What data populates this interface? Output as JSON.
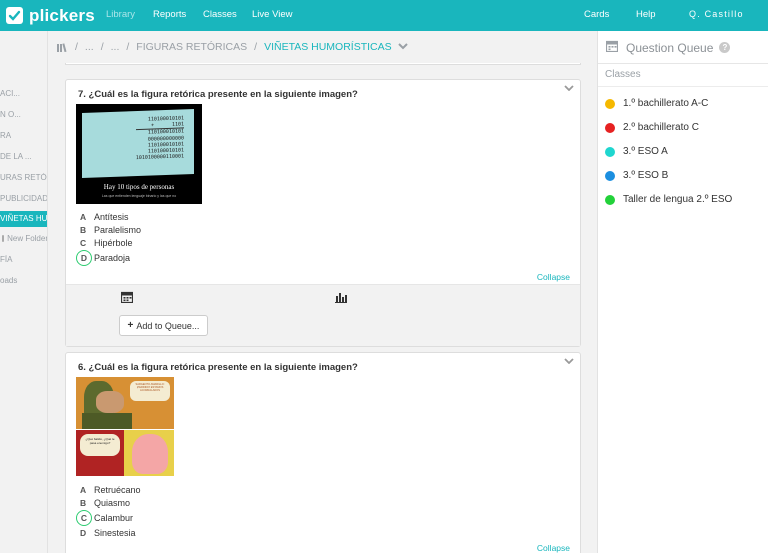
{
  "nav": {
    "logo_text": "plickers",
    "items": [
      "Library",
      "Reports",
      "Classes",
      "Live View"
    ],
    "cards": "Cards",
    "help": "Help",
    "user": "Q. Castillo"
  },
  "sidebar": {
    "items": [
      "ACI...",
      "N O...",
      "RA",
      "DE LA ...",
      "URAS RETÓ...",
      "PUBLICIDAD",
      "VIÑETAS HUM",
      "New Folder",
      "FÍA",
      "oads"
    ],
    "active_index": 6
  },
  "breadcrumb": {
    "items": [
      "...",
      "...",
      "FIGURAS RETÓRICAS",
      "VIÑETAS HUMORÍSTICAS"
    ]
  },
  "questions": [
    {
      "title": "7. ¿Cuál es la figura retórica presente en la siguiente imagen?",
      "image": {
        "binary_lines": [
          "110100010101",
          "1101",
          "110100010101",
          "000000000000",
          "110100010101",
          "110100010101",
          "1010100000110001"
        ],
        "plus_sign": "+",
        "caption": "Hay 10 tipos de personas",
        "subcaption": "Las que entienden lenguaje binario y las que no"
      },
      "choices": [
        {
          "letter": "A",
          "text": "Antítesis"
        },
        {
          "letter": "B",
          "text": "Paralelismo"
        },
        {
          "letter": "C",
          "text": "Hipérbole"
        },
        {
          "letter": "D",
          "text": "Paradoja"
        }
      ],
      "correct": "D",
      "collapse": "Collapse",
      "add_to_queue": "Add to Queue..."
    },
    {
      "title": "6. ¿Cuál es la figura retórica presente en la siguiente imagen?",
      "image": {
        "bubble_top": "SARGENTO AMARILLO: ¡PERDIDO! ESTAMOS ACORRALADOS",
        "bubble_bottom": "¿Qué batido, ¿Qué te pasa enemigo?"
      },
      "choices": [
        {
          "letter": "A",
          "text": "Retruécano"
        },
        {
          "letter": "B",
          "text": "Quiasmo"
        },
        {
          "letter": "C",
          "text": "Calambur"
        },
        {
          "letter": "D",
          "text": "Sinestesia"
        }
      ],
      "correct": "C",
      "collapse": "Collapse"
    }
  ],
  "queue": {
    "title": "Question Queue",
    "help": "?",
    "subtitle": "Classes",
    "classes": [
      {
        "name": "1.º bachillerato A-C",
        "color": "#f5b800"
      },
      {
        "name": "2.º bachillerato C",
        "color": "#e62222"
      },
      {
        "name": "3.º ESO A",
        "color": "#1fd6cf"
      },
      {
        "name": "3.º ESO B",
        "color": "#1b8fe0"
      },
      {
        "name": "Taller de lengua 2.º ESO",
        "color": "#22d13a"
      }
    ]
  },
  "colors": {
    "brand": "#19b6bd",
    "correct": "#2ecc71"
  }
}
